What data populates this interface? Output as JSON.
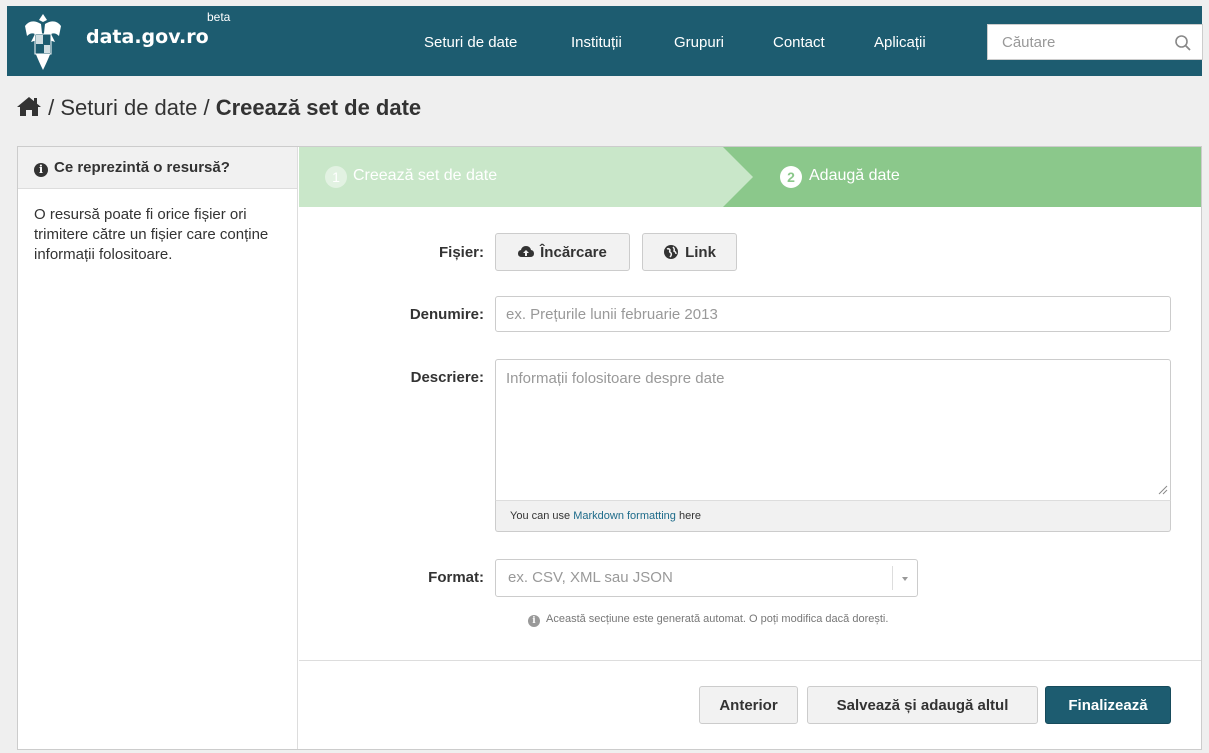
{
  "header": {
    "logo_text": "data.gov.ro",
    "beta_label": "beta",
    "nav": [
      "Seturi de date",
      "Instituții",
      "Grupuri",
      "Contact",
      "Aplicații"
    ],
    "search_placeholder": "Căutare"
  },
  "breadcrumb": {
    "home_icon": "home-icon",
    "sep": "/",
    "parent": "Seturi de date",
    "current": "Creează set de date"
  },
  "sidebar": {
    "title": "Ce reprezintă o resursă?",
    "body": "O resursă poate fi orice fișier ori trimitere către un fișier care conține informații folositoare."
  },
  "stages": [
    {
      "number": "1",
      "label": "Creează set de date",
      "state": "complete"
    },
    {
      "number": "2",
      "label": "Adaugă date",
      "state": "active"
    }
  ],
  "form": {
    "file_label": "Fișier:",
    "upload_button": "Încărcare",
    "link_button": "Link",
    "name_label": "Denumire:",
    "name_placeholder": "ex. Prețurile lunii februarie 2013",
    "description_label": "Descriere:",
    "description_placeholder": "Informații folositoare despre date",
    "markdown_prefix": "You can use ",
    "markdown_link": "Markdown formatting",
    "markdown_suffix": " here",
    "format_label": "Format:",
    "format_placeholder": "ex. CSV, XML sau JSON",
    "format_hint": "Această secțiune este generată automat. O poți modifica dacă dorești."
  },
  "actions": {
    "previous": "Anterior",
    "save_add_another": "Salvează și adaugă altul",
    "finish": "Finalizează"
  },
  "colors": {
    "header_bg": "#1d5c70",
    "stage_complete": "#c9e7c9",
    "stage_active": "#8bc88b",
    "primary_button": "#1d5c70"
  }
}
